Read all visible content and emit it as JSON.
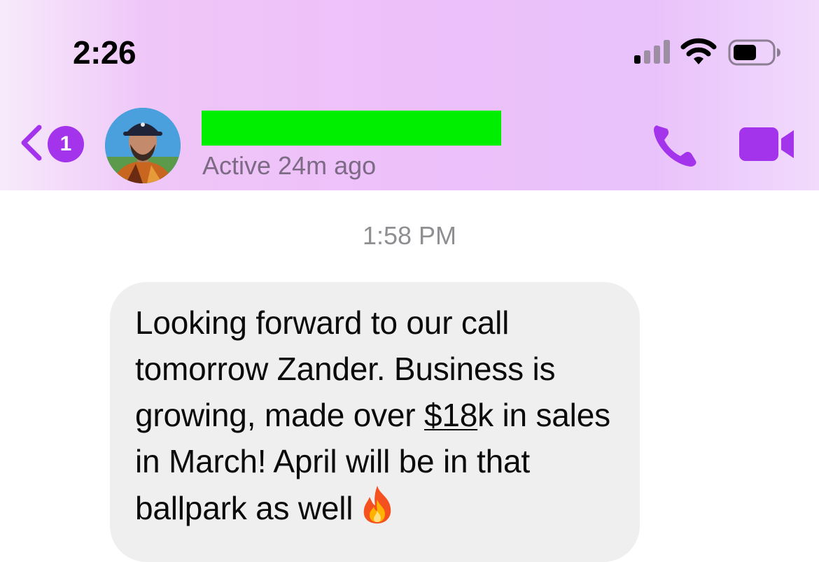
{
  "status_bar": {
    "time": "2:26",
    "icons": [
      "cellular-signal-icon",
      "wifi-icon",
      "battery-icon"
    ]
  },
  "header": {
    "unread_badge": "1",
    "contact_name": "",
    "contact_name_redacted": true,
    "active_status": "Active 24m ago",
    "icons": [
      "back-chevron-icon",
      "phone-icon",
      "video-camera-icon"
    ]
  },
  "conversation": {
    "timestamp": "1:58 PM",
    "message": {
      "before_link": "Looking forward to our call tomorrow Zander. Business is growing, made over ",
      "link": "$18",
      "after_link": "k in sales in March! April will be in that ballpark as well",
      "emoji": "fire-emoji"
    }
  },
  "colors": {
    "accent": "#a334ec",
    "redaction": "#00ee00",
    "bubble": "#efefef",
    "header_gradient": "#edc0fa"
  }
}
